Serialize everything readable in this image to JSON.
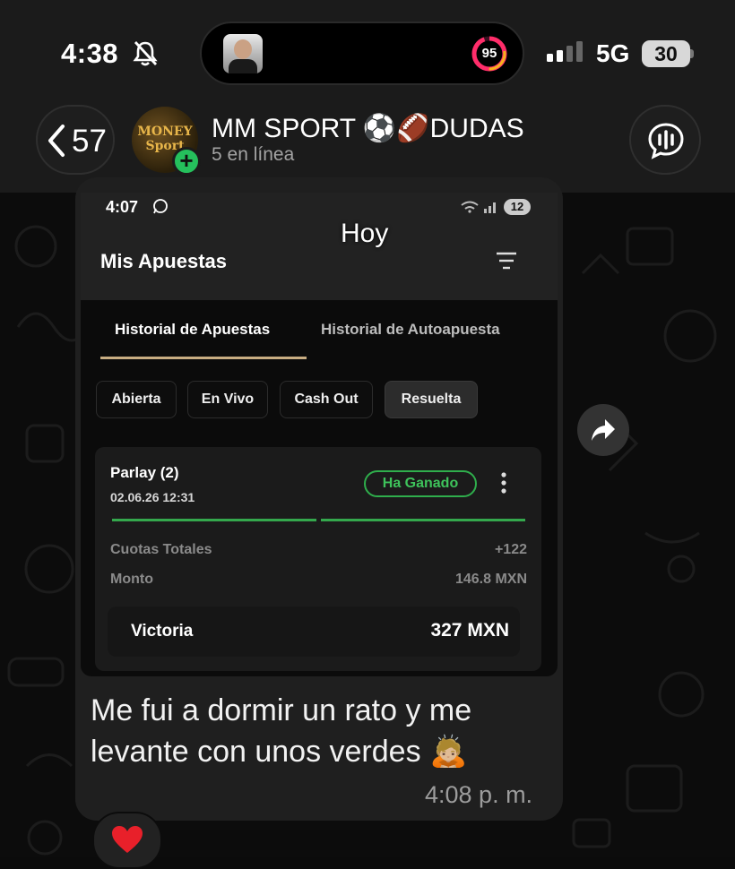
{
  "status_bar": {
    "time": "4:38",
    "island_ring_value": "95",
    "network": "5G",
    "battery": "30",
    "icons": [
      "bell-slash-icon",
      "signal-icon"
    ]
  },
  "chat_header": {
    "back_count": "57",
    "avatar_text": "MONEY Sport",
    "title": "MM SPORT ⚽🏈DUDAS",
    "subtitle": "5 en línea",
    "icons": [
      "chevron-left-icon",
      "plus-icon",
      "audio-call-icon"
    ]
  },
  "date_separator": "Hoy",
  "screenshot": {
    "time": "4:07",
    "battery_badge": "12",
    "title": "Mis Apuestas",
    "tabs": [
      "Historial de Apuestas",
      "Historial de Autoapuesta"
    ],
    "filters": [
      "Abierta",
      "En Vivo",
      "Cash Out",
      "Resuelta"
    ],
    "selected_filter": "Resuelta",
    "bet": {
      "type": "Parlay (2)",
      "datetime": "02.06.26 12:31",
      "status": "Ha Ganado",
      "odds_label": "Cuotas Totales",
      "odds_value": "+122",
      "stake_label": "Monto",
      "stake_value": "146.8 MXN",
      "win_label": "Victoria",
      "win_value": "327 MXN"
    },
    "colors": {
      "accent_tab": "#c8ad82",
      "won": "#2fae4c"
    }
  },
  "message": {
    "text": "Me fui a dormir un rato y me levante con unos verdes 🙇🏼",
    "time": "4:08 p. m."
  },
  "reaction": "❤️",
  "colors": {
    "bubble": "#1f1f1f",
    "header": "#1b1b1b",
    "online_green": "#25c05c"
  }
}
